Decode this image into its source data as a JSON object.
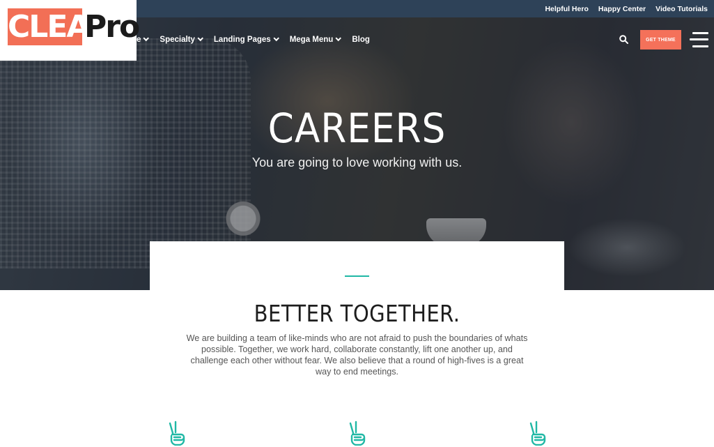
{
  "topbar": {
    "links": [
      "Helpful Hero",
      "Happy Center",
      "Video Tutorials"
    ]
  },
  "logo": {
    "word1": "CLEAN",
    "word2": "Pro",
    "accent_color": "#f26f56"
  },
  "nav": {
    "items": [
      {
        "label": "e",
        "has_dropdown": true
      },
      {
        "label": "Specialty",
        "has_dropdown": true
      },
      {
        "label": "Landing Pages",
        "has_dropdown": true
      },
      {
        "label": "Mega Menu",
        "has_dropdown": true
      },
      {
        "label": "Blog",
        "has_dropdown": false
      }
    ],
    "search_icon": "search-icon",
    "cta_label": "GET THEME",
    "cta_color": "#f4715a",
    "menu_icon": "hamburger-menu-icon"
  },
  "hero": {
    "title": "CAREERS",
    "subtitle": "You are going to love working with us."
  },
  "section": {
    "title": "BETTER TOGETHER.",
    "body": "We are building a team of like-minds who are not afraid to push the boundaries of whats possible. Together, we work hard, collaborate constantly, lift one another up, and challenge each other without fear.  We also believe that a round of high-fives is a great way to end meetings.",
    "accent_color": "#20b8a5"
  },
  "features": {
    "icons": [
      "peace-hand-icon",
      "peace-hand-icon",
      "peace-hand-icon"
    ]
  }
}
